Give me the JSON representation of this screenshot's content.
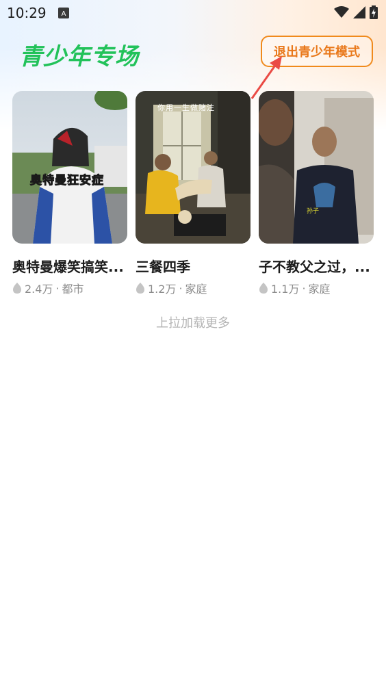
{
  "status_bar": {
    "time": "10:29"
  },
  "header": {
    "title": "青少年专场",
    "exit_button_label": "退出青少年模式"
  },
  "cards": [
    {
      "title": "奥特曼爆笑搞笑...",
      "views": "2.4万",
      "separator": "·",
      "category": "都市",
      "overlay_text": "奥特曼狂安症"
    },
    {
      "title": "三餐四季",
      "views": "1.2万",
      "separator": "·",
      "category": "家庭",
      "overlay_text": "你用一生做赌注"
    },
    {
      "title": "子不教父之过，...",
      "views": "1.1万",
      "separator": "·",
      "category": "家庭",
      "overlay_text": "孙子"
    }
  ],
  "footer": {
    "load_more": "上拉加载更多"
  },
  "colors": {
    "brand_green": "#22c25a",
    "accent_orange": "#f08a1c",
    "annotation_red": "#ea4b45"
  }
}
